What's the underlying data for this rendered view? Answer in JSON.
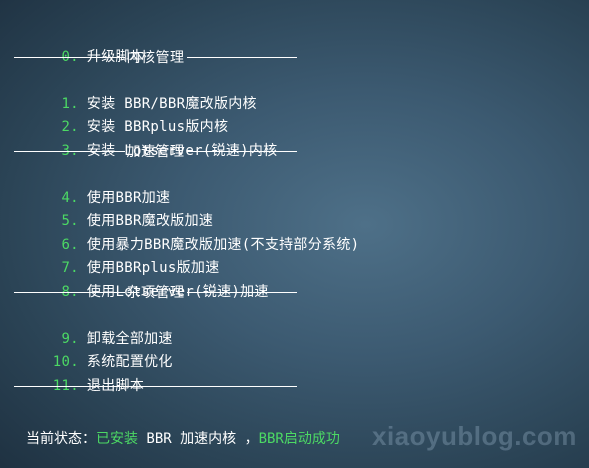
{
  "menu": {
    "top_item": {
      "num": "0.",
      "label": "升级脚本"
    },
    "sections": [
      {
        "title": "内核管理",
        "items": [
          {
            "num": "1.",
            "label": "安装 BBR/BBR魔改版内核"
          },
          {
            "num": "2.",
            "label": "安装 BBRplus版内核"
          },
          {
            "num": "3.",
            "label": "安装 Lotserver(锐速)内核"
          }
        ]
      },
      {
        "title": "加速管理",
        "items": [
          {
            "num": "4.",
            "label": "使用BBR加速"
          },
          {
            "num": "5.",
            "label": "使用BBR魔改版加速"
          },
          {
            "num": "6.",
            "label": "使用暴力BBR魔改版加速(不支持部分系统)"
          },
          {
            "num": "7.",
            "label": "使用BBRplus版加速"
          },
          {
            "num": "8.",
            "label": "使用Lotserver(锐速)加速"
          }
        ]
      },
      {
        "title": "杂项管理",
        "items": [
          {
            "num": "9.",
            "label": "卸载全部加速"
          },
          {
            "num": "10.",
            "label": "系统配置优化"
          },
          {
            "num": "11.",
            "label": "退出脚本"
          }
        ]
      }
    ]
  },
  "status": {
    "prefix": "当前状态：",
    "installed": "已安装",
    "kernel": " BBR 加速内核 ，",
    "running": "BBR启动成功"
  },
  "watermark": "xiaoyublog.com",
  "colors": {
    "number_green": "#4cd964",
    "text": "#ffffff",
    "background": "#3c5a71"
  }
}
